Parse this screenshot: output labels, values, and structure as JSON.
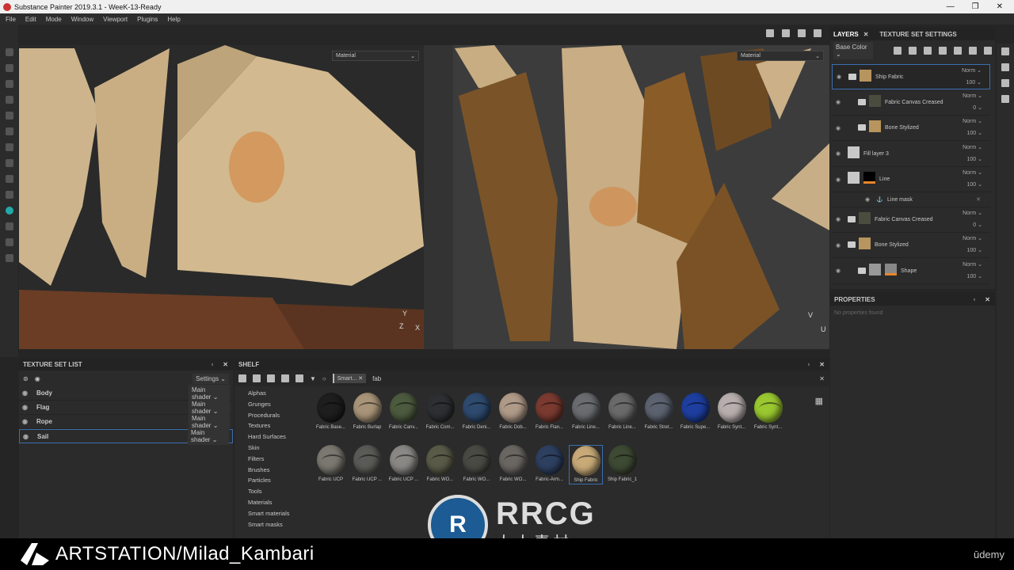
{
  "title": "Substance Painter 2019.3.1 - WeeK-13-Ready",
  "window_buttons": [
    "—",
    "❐",
    "✕"
  ],
  "menu": [
    "File",
    "Edit",
    "Mode",
    "Window",
    "Viewport",
    "Plugins",
    "Help"
  ],
  "viewport": {
    "left_select": "Material",
    "right_select": "Material",
    "axis_3d": {
      "x": "X",
      "y": "Y",
      "z": "Z"
    },
    "axis_2d": {
      "y": "V",
      "x": "U"
    }
  },
  "texture_set_list": {
    "title": "TEXTURE SET LIST",
    "settings": "Settings",
    "items": [
      {
        "name": "Body",
        "shader": "Main shader"
      },
      {
        "name": "Flag",
        "shader": "Main shader"
      },
      {
        "name": "Rope",
        "shader": "Main shader"
      },
      {
        "name": "Sail",
        "shader": "Main shader",
        "selected": true
      }
    ]
  },
  "shelf": {
    "title": "SHELF",
    "filter_chip": "Smart...",
    "search": "fab",
    "categories": [
      "Alphas",
      "Grunges",
      "Procedurals",
      "Textures",
      "Hard Surfaces",
      "Skin",
      "Filters",
      "Brushes",
      "Particles",
      "Tools",
      "Materials",
      "Smart materials",
      "Smart masks"
    ],
    "items": [
      {
        "label": "Fabric Base...",
        "color": "#1e1e1e"
      },
      {
        "label": "Fabric Burlap",
        "color": "#a89478"
      },
      {
        "label": "Fabric Canv...",
        "color": "#4c5a3e"
      },
      {
        "label": "Fabric Com...",
        "color": "#2e2f33"
      },
      {
        "label": "Fabric Deni...",
        "color": "#2e4a6e"
      },
      {
        "label": "Fabric Dob...",
        "color": "#b09a88"
      },
      {
        "label": "Fabric Flan...",
        "color": "#7a3a30"
      },
      {
        "label": "Fabric Line...",
        "color": "#6a6c70"
      },
      {
        "label": "Fabric Line...",
        "color": "#6a6a6a"
      },
      {
        "label": "Fabric Stret...",
        "color": "#5c6270"
      },
      {
        "label": "Fabric Supe...",
        "color": "#1e3fa0"
      },
      {
        "label": "Fabric Synt...",
        "color": "#b8aeae"
      },
      {
        "label": "Fabric Synt...",
        "color": "#9ac830"
      },
      {
        "label": "Fabric UCP",
        "color": "#7a7870"
      },
      {
        "label": "Fabric UCP ...",
        "color": "#5a5a56"
      },
      {
        "label": "Fabric UCP ...",
        "color": "#8a8884"
      },
      {
        "label": "Fabric WO...",
        "color": "#5a5a48"
      },
      {
        "label": "Fabric WO...",
        "color": "#4a4a44"
      },
      {
        "label": "Fabric WO...",
        "color": "#6a6662"
      },
      {
        "label": "Fabric-Arm...",
        "color": "#2e4060"
      },
      {
        "label": "Ship Fabric",
        "color": "#c8aa78",
        "selected": true
      },
      {
        "label": "Ship Fabric_1",
        "color": "#3e4a34"
      }
    ]
  },
  "layers": {
    "tab_layers": "LAYERS",
    "tab_tss": "TEXTURE SET SETTINGS",
    "channel": "Base Color",
    "rows": [
      {
        "name": "Ship Fabric",
        "blend": "Norm",
        "opacity": "100",
        "color": "#b8955e",
        "folder": true,
        "indent": 0,
        "selected": true
      },
      {
        "name": "Fabric Canvas Creased",
        "blend": "Norm",
        "opacity": "0",
        "color": "#4a4d3e",
        "folder": true,
        "indent": 1
      },
      {
        "name": "Bone Stylized",
        "blend": "Norm",
        "opacity": "100",
        "color": "#b8955e",
        "folder": true,
        "indent": 1
      },
      {
        "name": "Fill layer 3",
        "blend": "Norm",
        "opacity": "100",
        "color": "#c8c8c8",
        "folder": false,
        "indent": 0
      },
      {
        "name": "Line",
        "blend": "Norm",
        "opacity": "100",
        "color": "#c8c8c8",
        "folder": false,
        "indent": 0,
        "mask": true
      },
      {
        "name": "Fabric Canvas Creased",
        "blend": "Norm",
        "opacity": "0",
        "color": "#4a4d3e",
        "folder": true,
        "indent": 0
      },
      {
        "name": "Bone Stylized",
        "blend": "Norm",
        "opacity": "100",
        "color": "#b8955e",
        "folder": true,
        "indent": 0
      },
      {
        "name": "Shape",
        "blend": "Norm",
        "opacity": "100",
        "color": "#999",
        "folder": true,
        "indent": 1,
        "mask": true
      }
    ],
    "mask_row": "Line mask"
  },
  "properties": {
    "title": "PROPERTIES",
    "empty": "No properties found"
  },
  "banner": {
    "artstation": "ARTSTATION/Milad_Kambari",
    "udemy": "ūdemy"
  },
  "watermark": {
    "logo": "RRCG",
    "sub": "人人素材"
  }
}
